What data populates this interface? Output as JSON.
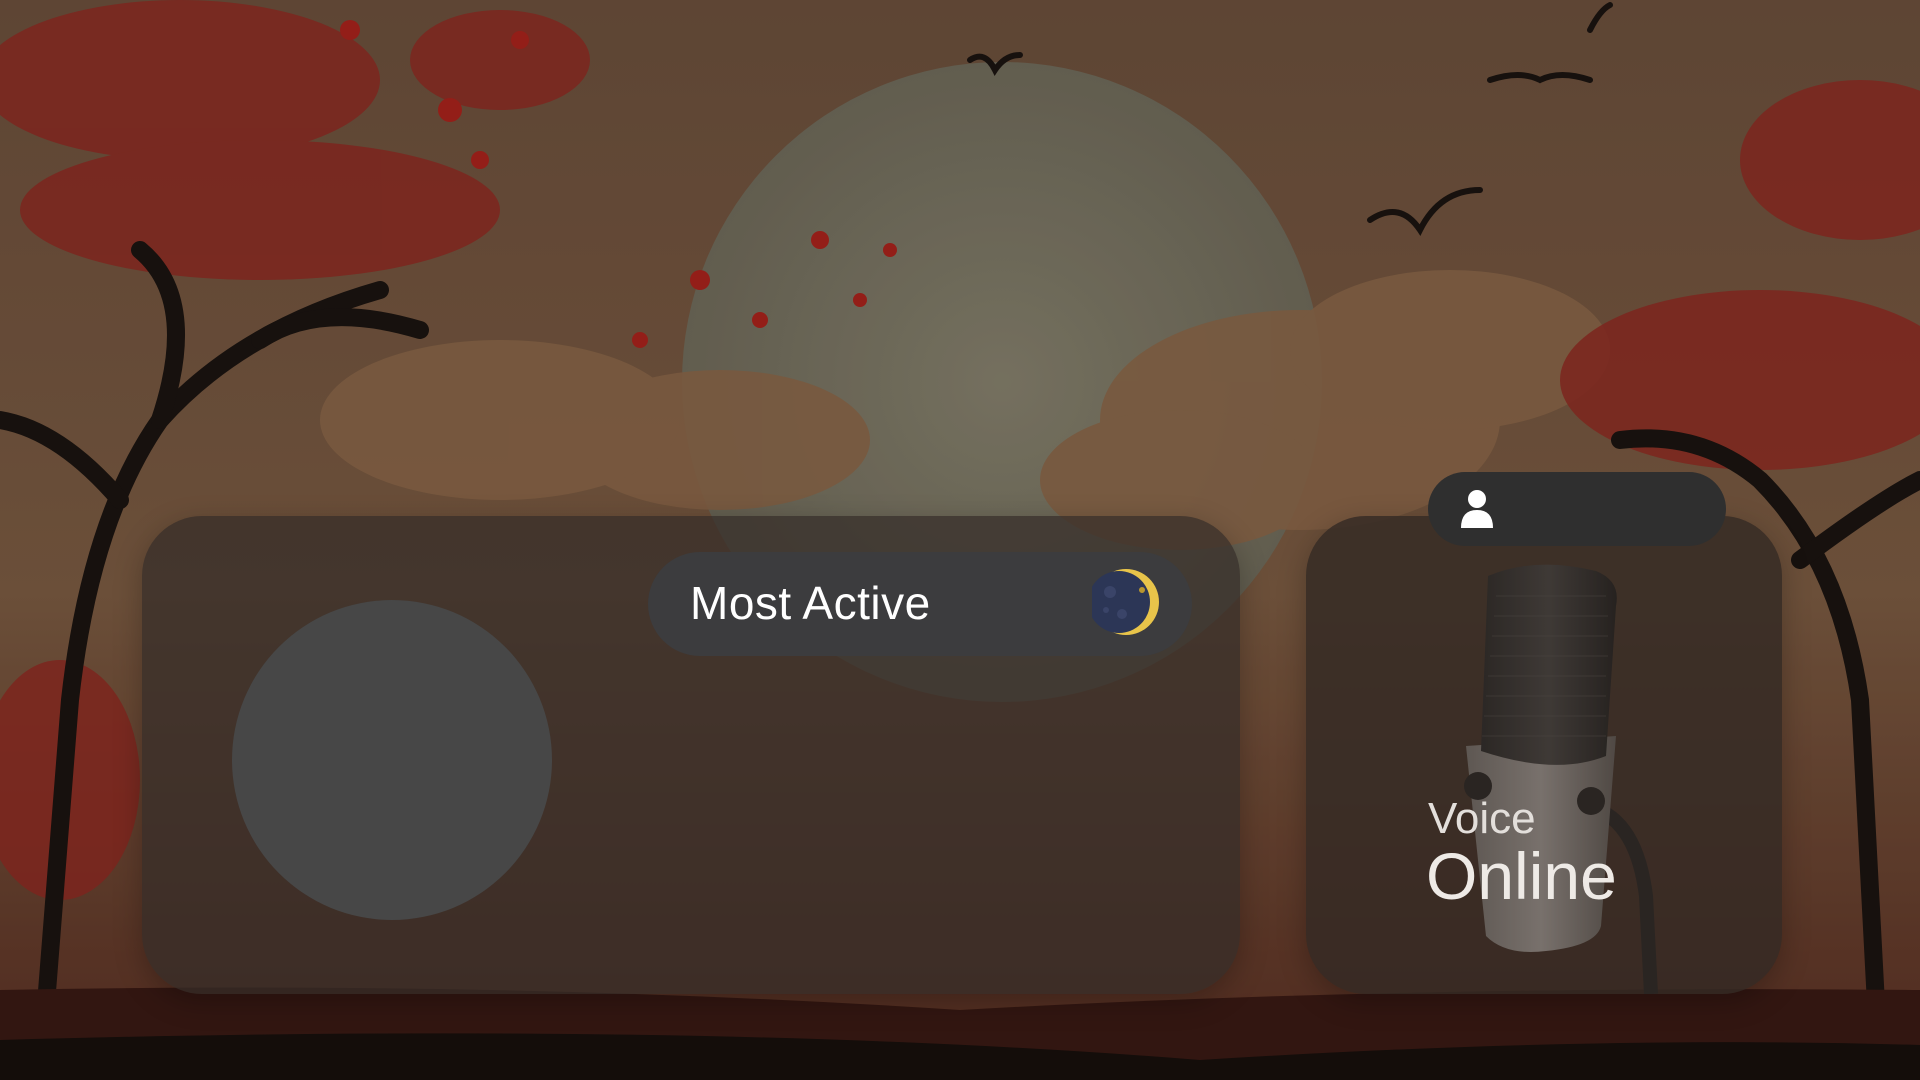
{
  "most_active": {
    "label": "Most Active",
    "icon": "moon-icon"
  },
  "avatar": {
    "icon": "avatar-placeholder"
  },
  "voice": {
    "label": "Voice",
    "status": "Online",
    "icon": "microphone-icon"
  },
  "user": {
    "icon": "user-icon",
    "name": ""
  },
  "colors": {
    "card_bg": "#342c28",
    "pill_bg": "#3c3c3e",
    "avatar_bg": "#474747",
    "text_primary": "#ffffff"
  }
}
